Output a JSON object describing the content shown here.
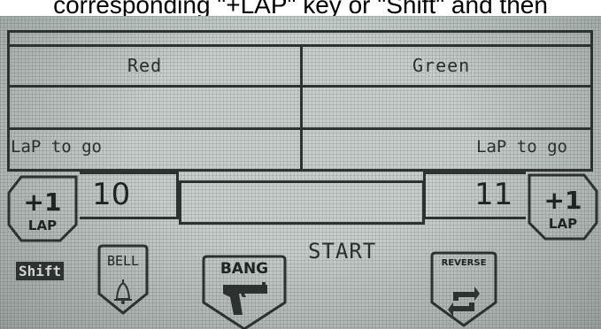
{
  "caption": "corresponding \"+LAP\" key or \"Shift\" and then",
  "lanes": {
    "left": {
      "name": "Red",
      "lap_label": "LaP to go",
      "count": "10"
    },
    "right": {
      "name": "Green",
      "lap_label": "LaP to go",
      "count": "11"
    }
  },
  "buttons": {
    "lap_plus": "+1",
    "lap_word": "LAP",
    "shift": "Shift",
    "bell": "BELL",
    "bang": "BANG",
    "start": "START",
    "reverse": "REVERSE"
  },
  "icons": {
    "bell": "bell-icon",
    "gun": "pistol-icon",
    "reverse": "reverse-arrows-icon"
  },
  "colors": {
    "lcd_background": "#c8cecb",
    "lcd_ink": "#2d3130"
  }
}
